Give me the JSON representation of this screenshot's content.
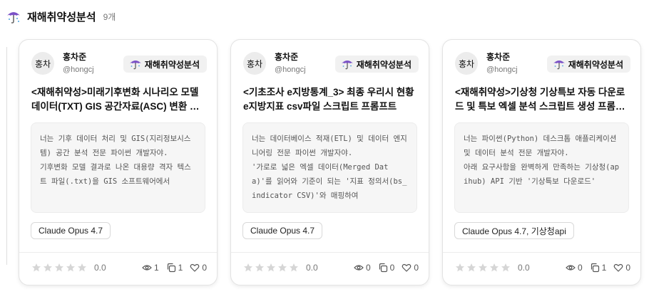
{
  "header": {
    "icon": "umbrella-icon",
    "title": "재해취약성분석",
    "count": "9개"
  },
  "colors": {
    "umbrella_canopy": "#7b52c7",
    "umbrella_accent": "#4aa3df",
    "star_empty": "#d6d6d6",
    "card_border": "#e3e3e3",
    "prompt_bg": "#f6f6f6"
  },
  "cards": [
    {
      "avatar": "홍차",
      "author_name": "홍차준",
      "author_handle": "@hongcj",
      "category": "재해취약성분석",
      "title": "<재해취약성>미래기후변화 시나리오 모델 데이터(TXT) GIS 공간자료(ASC) 변환 스크립트",
      "prompt": "너는 기후 데이터 처리 및 GIS(지리정보시스템) 공간 분석 전문 파이썬 개발자야.\n기후변화 모델 결과로 나온 대용량 격자 텍스트 파일(.txt)을 GIS 소프트웨어에서",
      "model": "Claude Opus 4.7",
      "rating": 0,
      "rating_label": "0.0",
      "views": "1",
      "copies": "1",
      "likes": "0"
    },
    {
      "avatar": "홍차",
      "author_name": "홍차준",
      "author_handle": "@hongcj",
      "category": "재해취약성분석",
      "title": "<기초조사 e지방통계_3> 최종 우리시 현황 e지방지표 csv파일 스크립트 프롬프트",
      "prompt": "너는 데이터베이스 적재(ETL) 및 데이터 엔지니어링 전문 파이썬 개발자야.\n'가로로 넓은 엑셀 데이터(Merged Data)'를 읽어와 기준이 되는 '지표 정의서(bs_indicator CSV)'와 매핑하여",
      "model": "Claude Opus 4.7",
      "rating": 0,
      "rating_label": "0.0",
      "views": "0",
      "copies": "0",
      "likes": "0"
    },
    {
      "avatar": "홍차",
      "author_name": "홍차준",
      "author_handle": "@hongcj",
      "category": "재해취약성분석",
      "title": "<재해취약성>기상청 기상특보 자동 다운로드 및 특보 엑셀 분석 스크립트 생성 프롬프트",
      "prompt": "너는 파이썬(Python) 데스크톱 애플리케이션 및 데이터 분석 전문 개발자야.\n아래 요구사항을 완벽하게 만족하는 기상청(apihub) API 기반 '기상특보 다운로드'",
      "model": "Claude Opus 4.7, 기상청api",
      "rating": 0,
      "rating_label": "0.0",
      "views": "0",
      "copies": "1",
      "likes": "0"
    }
  ]
}
